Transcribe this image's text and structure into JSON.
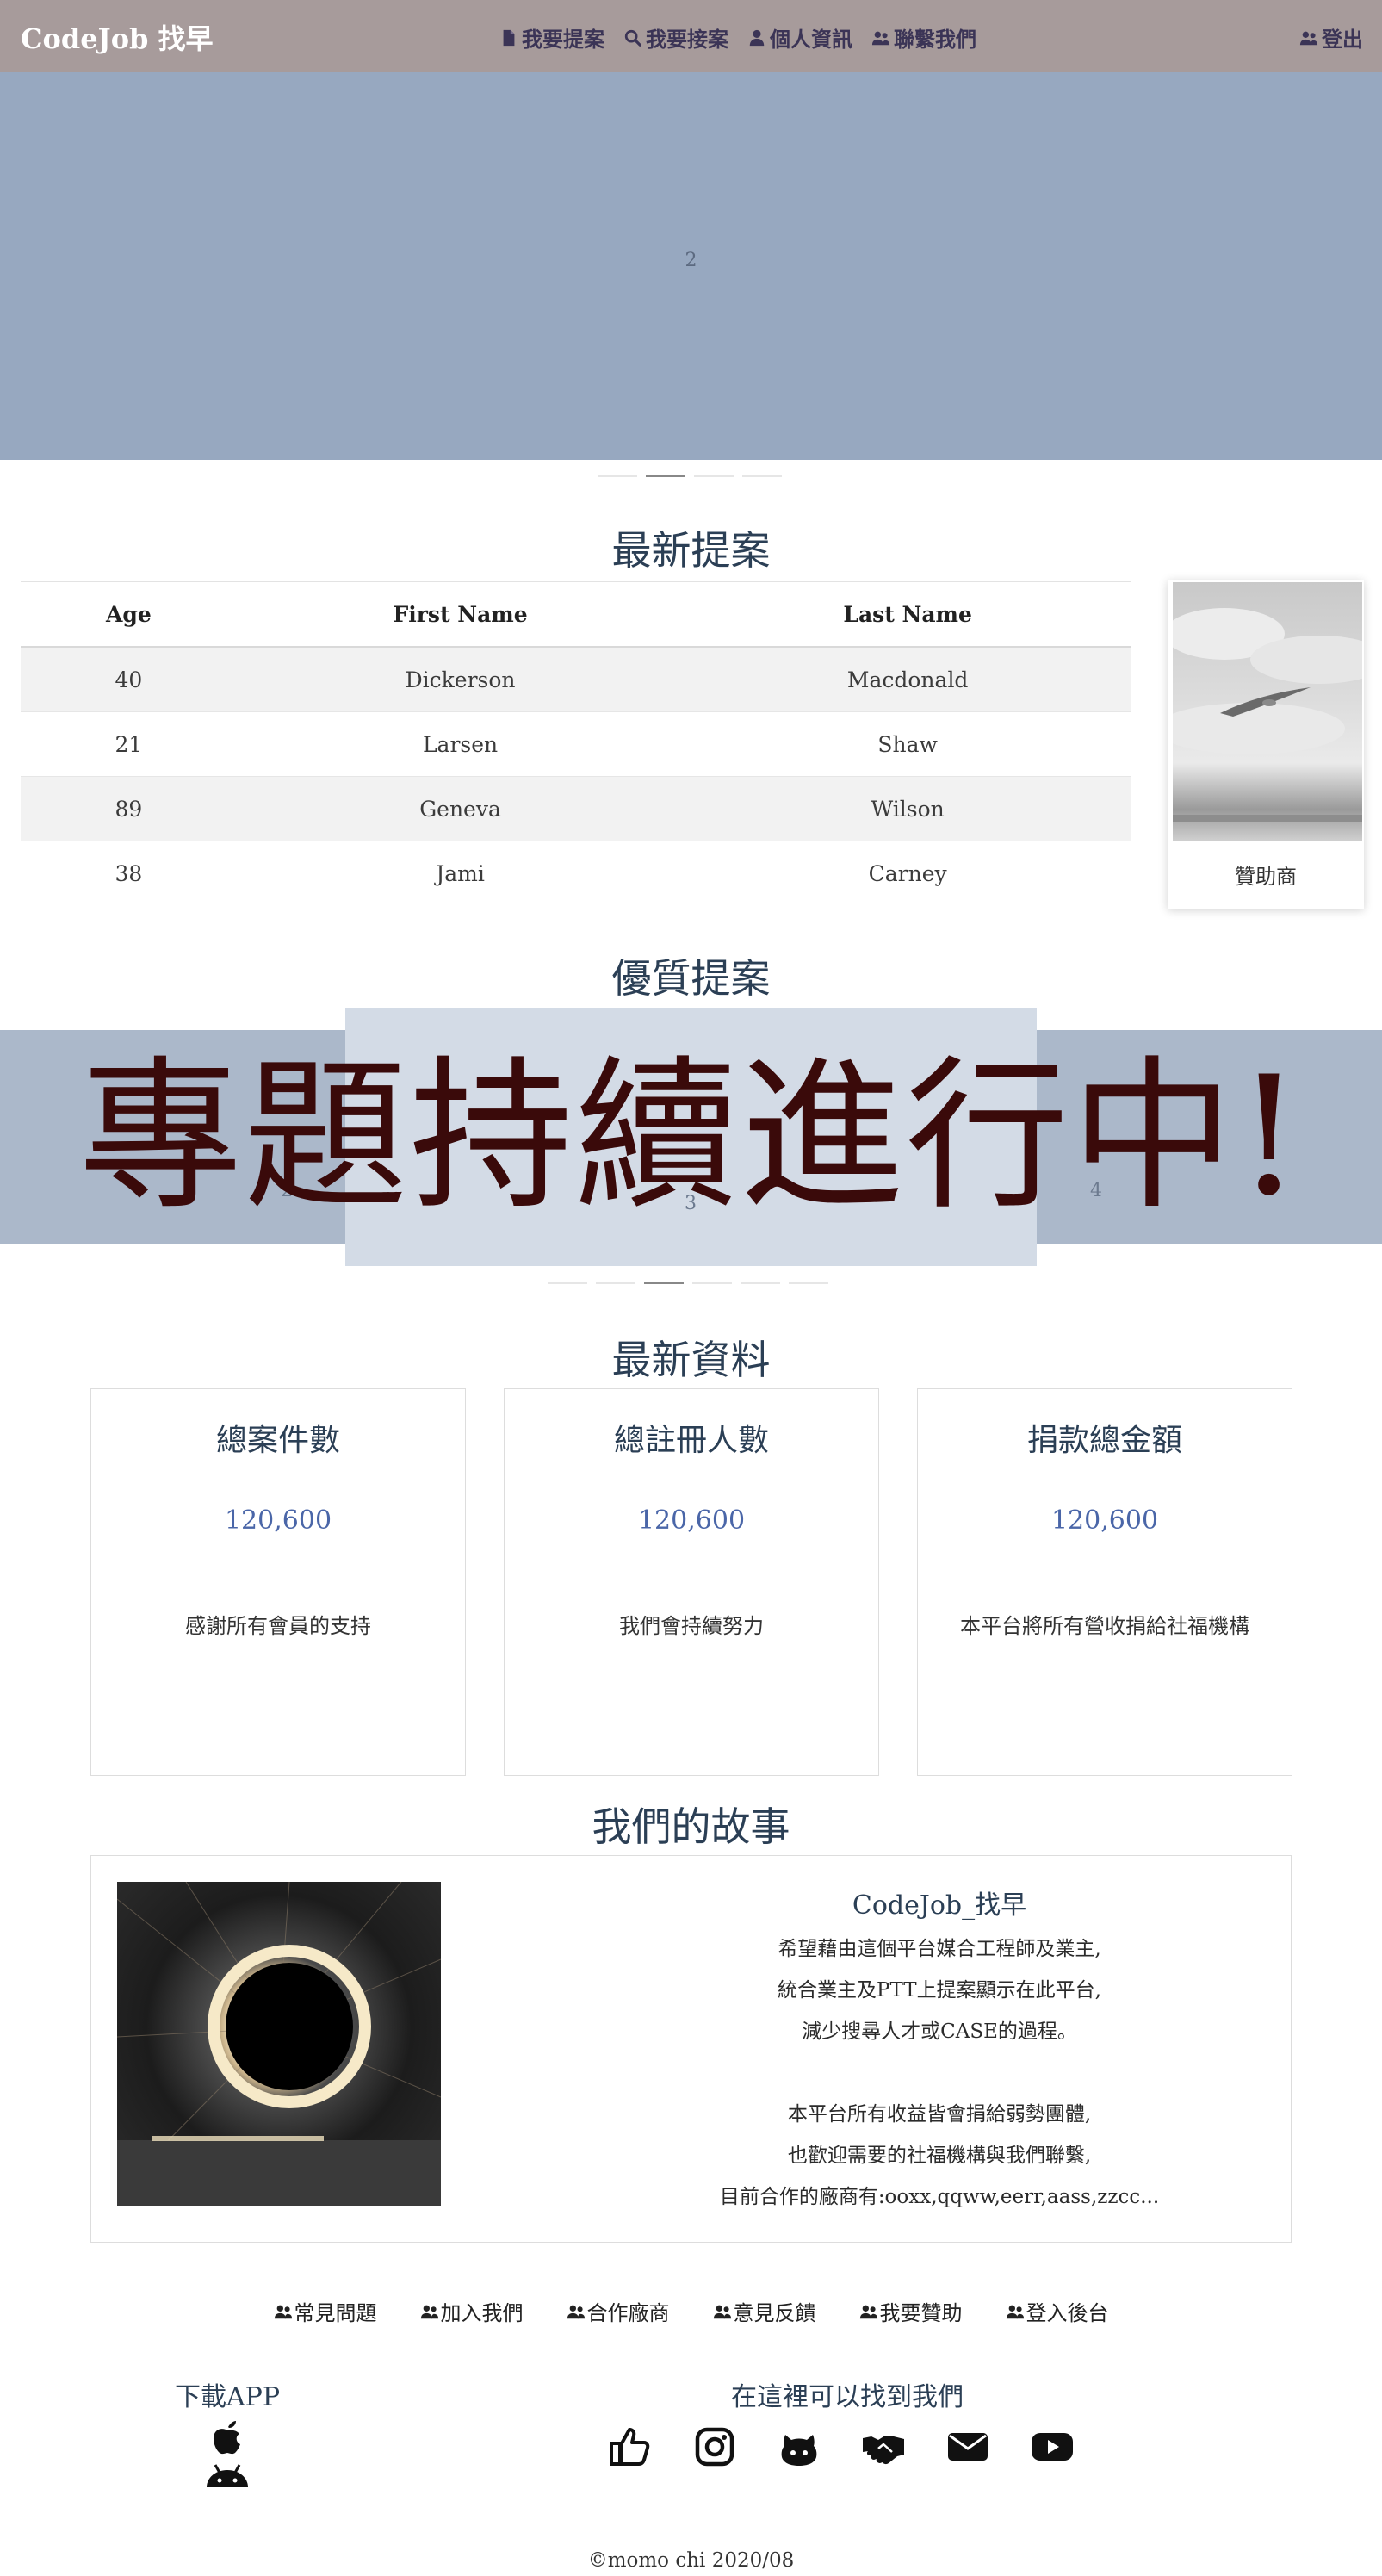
{
  "navbar": {
    "brand": "CodeJob 找早",
    "links": [
      {
        "label": "我要提案",
        "icon": "file-icon"
      },
      {
        "label": "我要接案",
        "icon": "search-icon"
      },
      {
        "label": "個人資訊",
        "icon": "user-icon"
      },
      {
        "label": "聯繫我們",
        "icon": "users-icon"
      }
    ],
    "logout": "登出"
  },
  "hero": {
    "slide_number": "2",
    "indicator_count": 4,
    "active_index": 1
  },
  "latest_proposals": {
    "title": "最新提案",
    "columns": [
      "Age",
      "First Name",
      "Last Name"
    ],
    "rows": [
      [
        "40",
        "Dickerson",
        "Macdonald"
      ],
      [
        "21",
        "Larsen",
        "Shaw"
      ],
      [
        "89",
        "Geneva",
        "Wilson"
      ],
      [
        "38",
        "Jami",
        "Carney"
      ]
    ]
  },
  "sponsor": {
    "label": "贊助商"
  },
  "quality_proposals": {
    "title": "優質提案",
    "slides": [
      "2",
      "3",
      "4"
    ],
    "banner": "專題持續進行中!",
    "indicator_count": 6,
    "active_index": 2
  },
  "latest_info": {
    "title": "最新資料",
    "cards": [
      {
        "title": "總案件數",
        "value": "120,600",
        "desc": "感謝所有會員的支持"
      },
      {
        "title": "總註冊人數",
        "value": "120,600",
        "desc": "我們會持續努力"
      },
      {
        "title": "捐款總金額",
        "value": "120,600",
        "desc": "本平台將所有營收捐給社福機構"
      }
    ]
  },
  "story": {
    "title": "我們的故事",
    "heading": "CodeJob_找早",
    "lines": [
      "希望藉由這個平台媒合工程師及業主,",
      "統合業主及PTT上提案顯示在此平台,",
      "減少搜尋人才或CASE的過程。",
      "",
      "本平台所有收益皆會捐給弱勢團體,",
      "也歡迎需要的社福機構與我們聯繫,",
      "目前合作的廠商有:ooxx,qqww,eerr,aass,zzcc..."
    ]
  },
  "footer": {
    "links": [
      "常見問題",
      "加入我們",
      "合作廠商",
      "意見反饋",
      "我要贊助",
      "登入後台"
    ],
    "download_title": "下載APP",
    "find_title": "在這裡可以找到我們",
    "app_icons": [
      "apple-icon",
      "android-icon"
    ],
    "social_icons": [
      "thumbs-up-icon",
      "instagram-icon",
      "github-icon",
      "handshake-icon",
      "envelope-icon",
      "youtube-icon"
    ],
    "copyright": "©momo chi 2020/08"
  },
  "colors": {
    "navbar": "#a79b9b",
    "hero": "#97a8c0",
    "carousel": "#abb8ca",
    "carousel_active": "#d3dbe6",
    "banner_text": "#3a0a0a",
    "stat_value": "#4a66a8"
  }
}
